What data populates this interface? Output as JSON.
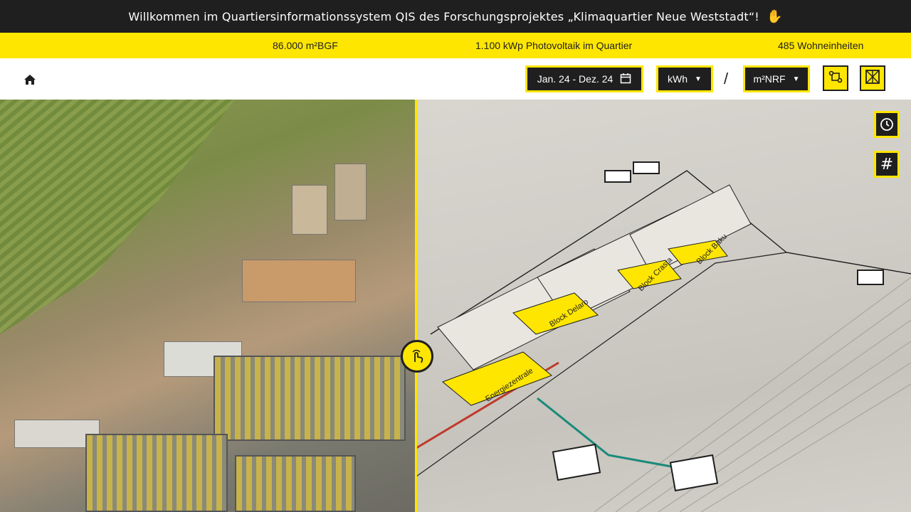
{
  "banner": {
    "title": "Willkommen im Quartiersinformationssystem QIS des Forschungsprojektes „Klimaquartier Neue Weststadt“!",
    "icon": "hand-wave-icon"
  },
  "stats": {
    "area": "86.000 m²BGF",
    "pv": "1.100 kWp Photovoltaik im Quartier",
    "units": "485 Wohneinheiten"
  },
  "toolbar": {
    "home_icon": "home-icon",
    "date_range": "Jan. 24 - Dez. 24",
    "unit": "kWh",
    "separator": "/",
    "reference": "m²NRF",
    "filter_icon": "network-icon",
    "compare_icon": "compare-icon"
  },
  "map": {
    "blocks": [
      "Energiezentrale",
      "Block Delaro",
      "Block Crasta",
      "Block Baku"
    ],
    "side_icons": [
      "history-icon",
      "grid-hash-icon"
    ],
    "swipe_icon": "touch-swipe-icon"
  },
  "colors": {
    "accent": "#ffe600",
    "dark": "#1f1f1f"
  }
}
